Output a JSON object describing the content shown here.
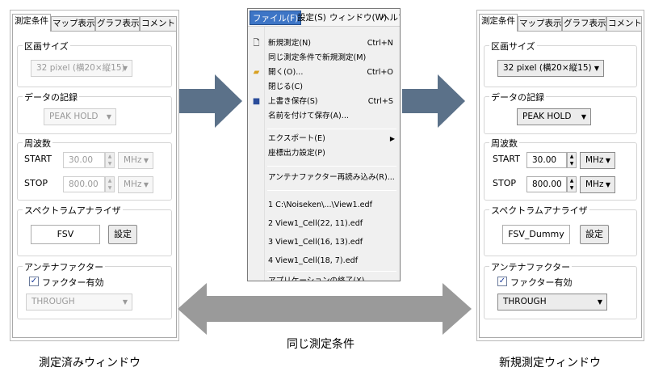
{
  "colors": {
    "arrow_blue": "#5b7189",
    "arrow_gray": "#9a9a9a",
    "menu_highlight": "#3d75c6"
  },
  "left_panel": {
    "tabs": [
      "測定条件",
      "マップ表示",
      "グラフ表示",
      "コメント"
    ],
    "area_size": {
      "title": "区画サイズ",
      "value": "32 pixel (横20×縦15)"
    },
    "data_record": {
      "title": "データの記録",
      "value": "PEAK HOLD"
    },
    "frequency": {
      "title": "周波数",
      "start_label": "START",
      "start_value": "30.00",
      "start_unit": "MHz",
      "stop_label": "STOP",
      "stop_value": "800.00",
      "stop_unit": "MHz"
    },
    "spectrum": {
      "title": "スペクトラムアナライザ",
      "value": "FSV",
      "settings_button": "設定"
    },
    "antenna": {
      "title": "アンテナファクター",
      "checkbox_label": "ファクター有効",
      "value": "THROUGH"
    }
  },
  "right_panel": {
    "tabs": [
      "測定条件",
      "マップ表示",
      "グラフ表示",
      "コメント"
    ],
    "area_size": {
      "title": "区画サイズ",
      "value": "32 pixel (横20×縦15)"
    },
    "data_record": {
      "title": "データの記録",
      "value": "PEAK HOLD"
    },
    "frequency": {
      "title": "周波数",
      "start_label": "START",
      "start_value": "30.00",
      "start_unit": "MHz",
      "stop_label": "STOP",
      "stop_value": "800.00",
      "stop_unit": "MHz"
    },
    "spectrum": {
      "title": "スペクトラムアナライザ",
      "value": "FSV_Dummy",
      "settings_button": "設定"
    },
    "antenna": {
      "title": "アンテナファクター",
      "checkbox_label": "ファクター有効",
      "value": "THROUGH"
    }
  },
  "menubar": {
    "file": "ファイル(F)",
    "settings": "設定(S)",
    "window": "ウィンドウ(W)",
    "help": "ヘルプ"
  },
  "file_menu": {
    "new_measure": {
      "label": "新規測定(N)",
      "shortcut": "Ctrl+N",
      "icon": "new-file-icon"
    },
    "new_same": {
      "label": "同じ測定条件で新規測定(M)"
    },
    "open": {
      "label": "開く(O)...",
      "shortcut": "Ctrl+O",
      "icon": "folder-icon"
    },
    "close": {
      "label": "閉じる(C)"
    },
    "save": {
      "label": "上書き保存(S)",
      "shortcut": "Ctrl+S",
      "icon": "save-icon"
    },
    "save_as": {
      "label": "名前を付けて保存(A)..."
    },
    "export": {
      "label": "エクスポート(E)"
    },
    "coord_output": {
      "label": "座標出力設定(P)"
    },
    "antenna_reload": {
      "label": "アンテナファクター再読み込み(R)..."
    },
    "recent": [
      "1 C:\\Noiseken\\...\\View1.edf",
      "2 View1_Cell(22, 11).edf",
      "3 View1_Cell(16, 13).edf",
      "4 View1_Cell(18, 7).edf"
    ],
    "exit": {
      "label": "アプリケーションの終了(X)"
    }
  },
  "captions": {
    "left": "測定済みウィンドウ",
    "right": "新規測定ウィンドウ",
    "middle": "同じ測定条件"
  }
}
